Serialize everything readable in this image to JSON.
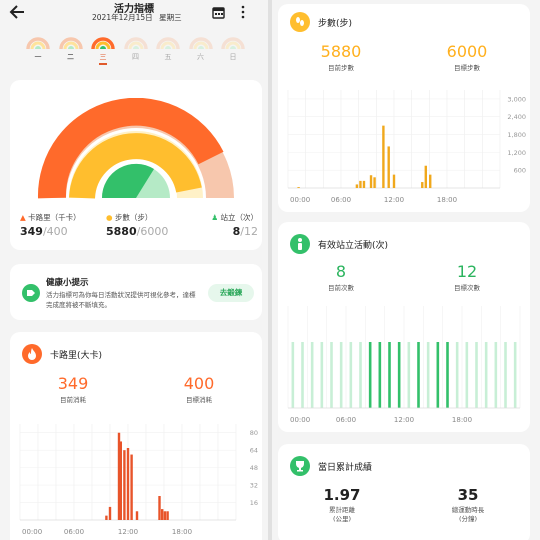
{
  "header": {
    "title": "活力指標",
    "date": "2021年12月15日",
    "weekday": "星期三"
  },
  "week": {
    "days": [
      "一",
      "二",
      "三",
      "四",
      "五",
      "六",
      "日"
    ],
    "selected_index": 2
  },
  "summary": {
    "calories": {
      "label": "卡路里（千卡）",
      "current": "349",
      "target": "/400"
    },
    "steps": {
      "label": "步數（步）",
      "current": "5880",
      "target": "/6000"
    },
    "stand": {
      "label": "站立（次）",
      "current": "8",
      "target": "/12"
    }
  },
  "tip": {
    "title": "健康小提示",
    "text": "活力指標可為你每日活動狀況提供可視化參考，達標完成度將被不斷填充。",
    "button": "去鍛鍊"
  },
  "calories_card": {
    "title": "卡路里(大卡)",
    "current": "349",
    "current_label": "目前消耗",
    "target": "400",
    "target_label": "目標消耗"
  },
  "steps_card": {
    "title": "步數(步)",
    "current": "5880",
    "current_label": "目前步數",
    "target": "6000",
    "target_label": "目標步數"
  },
  "stand_card": {
    "title": "有效站立活動(次)",
    "current": "8",
    "current_label": "目前次數",
    "target": "12",
    "target_label": "目標次數"
  },
  "achievement_card": {
    "title": "當日累計成績",
    "distance": "1.97",
    "distance_label": "累計距離\n(公里)",
    "duration": "35",
    "duration_label": "總運動時長\n(分鐘)"
  },
  "colors": {
    "calories": "#ff6a2b",
    "steps": "#ffbe2e",
    "stand": "#33c06a",
    "gauge_bg": "#f7c7ad"
  },
  "chart_data": [
    {
      "type": "bar",
      "title": "卡路里(大卡)",
      "x_tick_labels": [
        "00:00",
        "06:00",
        "12:00",
        "18:00"
      ],
      "y_tick_labels": [
        "80",
        "64",
        "48",
        "32",
        "16"
      ],
      "ylim": [
        0,
        88
      ],
      "x_range": [
        0,
        24
      ],
      "series": [
        {
          "x": [
            9.6,
            10.0,
            11.0,
            11.2,
            11.6,
            12.0,
            12.4,
            13.0,
            15.5,
            15.8,
            16.1,
            16.4
          ],
          "values": [
            4,
            12,
            80,
            72,
            64,
            66,
            60,
            8,
            22,
            10,
            8,
            8
          ]
        }
      ]
    },
    {
      "type": "bar",
      "title": "步數(步)",
      "x_tick_labels": [
        "00:00",
        "06:00",
        "12:00",
        "18:00"
      ],
      "y_tick_labels": [
        "3,000",
        "2,400",
        "1,800",
        "1,200",
        "600"
      ],
      "ylim": [
        0,
        3300
      ],
      "x_range": [
        0,
        24
      ],
      "series": [
        {
          "x": [
            1.2,
            7.8,
            8.2,
            8.6,
            9.4,
            9.8,
            10.8,
            11.4,
            12.0,
            15.2,
            15.6,
            16.1
          ],
          "values": [
            30,
            120,
            240,
            240,
            430,
            360,
            2100,
            1400,
            450,
            200,
            750,
            450
          ]
        }
      ]
    },
    {
      "type": "bar",
      "title": "有效站立活動(次)",
      "x_tick_labels": [
        "00:00",
        "06:00",
        "12:00",
        "18:00"
      ],
      "hours": [
        0,
        1,
        2,
        3,
        4,
        5,
        6,
        7,
        8,
        9,
        10,
        11,
        12,
        13,
        14,
        15,
        16,
        17,
        18,
        19,
        20,
        21,
        22,
        23
      ],
      "active": [
        0,
        0,
        0,
        0,
        0,
        0,
        0,
        0,
        1,
        1,
        1,
        1,
        0,
        1,
        0,
        1,
        1,
        0,
        0,
        0,
        0,
        0,
        0,
        0
      ]
    }
  ]
}
